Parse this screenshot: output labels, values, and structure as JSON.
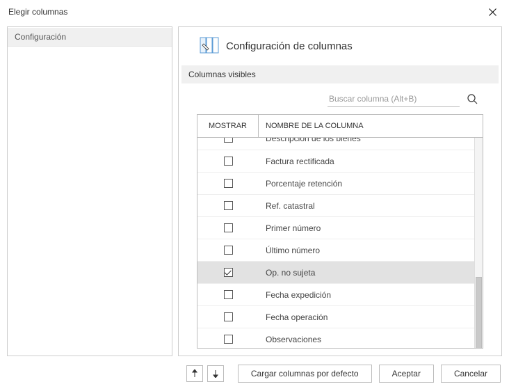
{
  "title": "Elegir columnas",
  "sidebar": {
    "items": [
      {
        "label": "Configuración"
      }
    ]
  },
  "section": {
    "title": "Configuración de columnas",
    "subheader": "Columnas visibles"
  },
  "search": {
    "placeholder": "Buscar columna (Alt+B)"
  },
  "grid": {
    "headers": {
      "show": "MOSTRAR",
      "name": "NOMBRE DE LA COLUMNA"
    },
    "rows": [
      {
        "checked": false,
        "name": "Descripción de los bienes",
        "clipped": true
      },
      {
        "checked": false,
        "name": "Factura rectificada"
      },
      {
        "checked": false,
        "name": "Porcentaje retención"
      },
      {
        "checked": false,
        "name": "Ref. catastral"
      },
      {
        "checked": false,
        "name": "Primer número"
      },
      {
        "checked": false,
        "name": "Último número"
      },
      {
        "checked": true,
        "name": "Op. no sujeta",
        "selected": true
      },
      {
        "checked": false,
        "name": "Fecha expedición"
      },
      {
        "checked": false,
        "name": "Fecha operación"
      },
      {
        "checked": false,
        "name": "Observaciones"
      }
    ]
  },
  "buttons": {
    "load_default": "Cargar columnas por defecto",
    "ok": "Aceptar",
    "cancel": "Cancelar"
  }
}
